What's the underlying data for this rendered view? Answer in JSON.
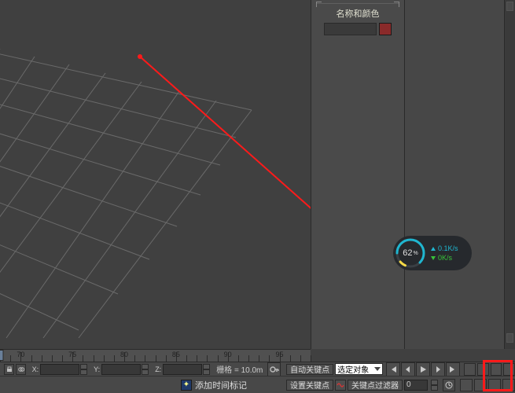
{
  "panel": {
    "title": "名称和颜色",
    "object_name": "",
    "swatch_color": "#8a2a2a"
  },
  "speed": {
    "percent": "62",
    "percent_suffix": "%",
    "up": "0.1K/s",
    "down": "0K/s"
  },
  "ruler": {
    "visible_labels": [
      "70",
      "75",
      "80",
      "85",
      "90",
      "95"
    ],
    "marker_at": 68
  },
  "coords": {
    "x_label": "X:",
    "x_value": "",
    "y_label": "Y:",
    "y_value": "",
    "z_label": "Z:",
    "z_value": "",
    "grid_label": "栅格 = 10.0m"
  },
  "anim": {
    "auto_key": "自动关键点",
    "set_key": "设置关键点",
    "selected_dropdown": "选定对象",
    "key_filters": "关键点过滤器",
    "frame": "0",
    "add_time_tag": "添加时间标记"
  },
  "icons": {
    "key": "⊸",
    "wave": "∿"
  }
}
